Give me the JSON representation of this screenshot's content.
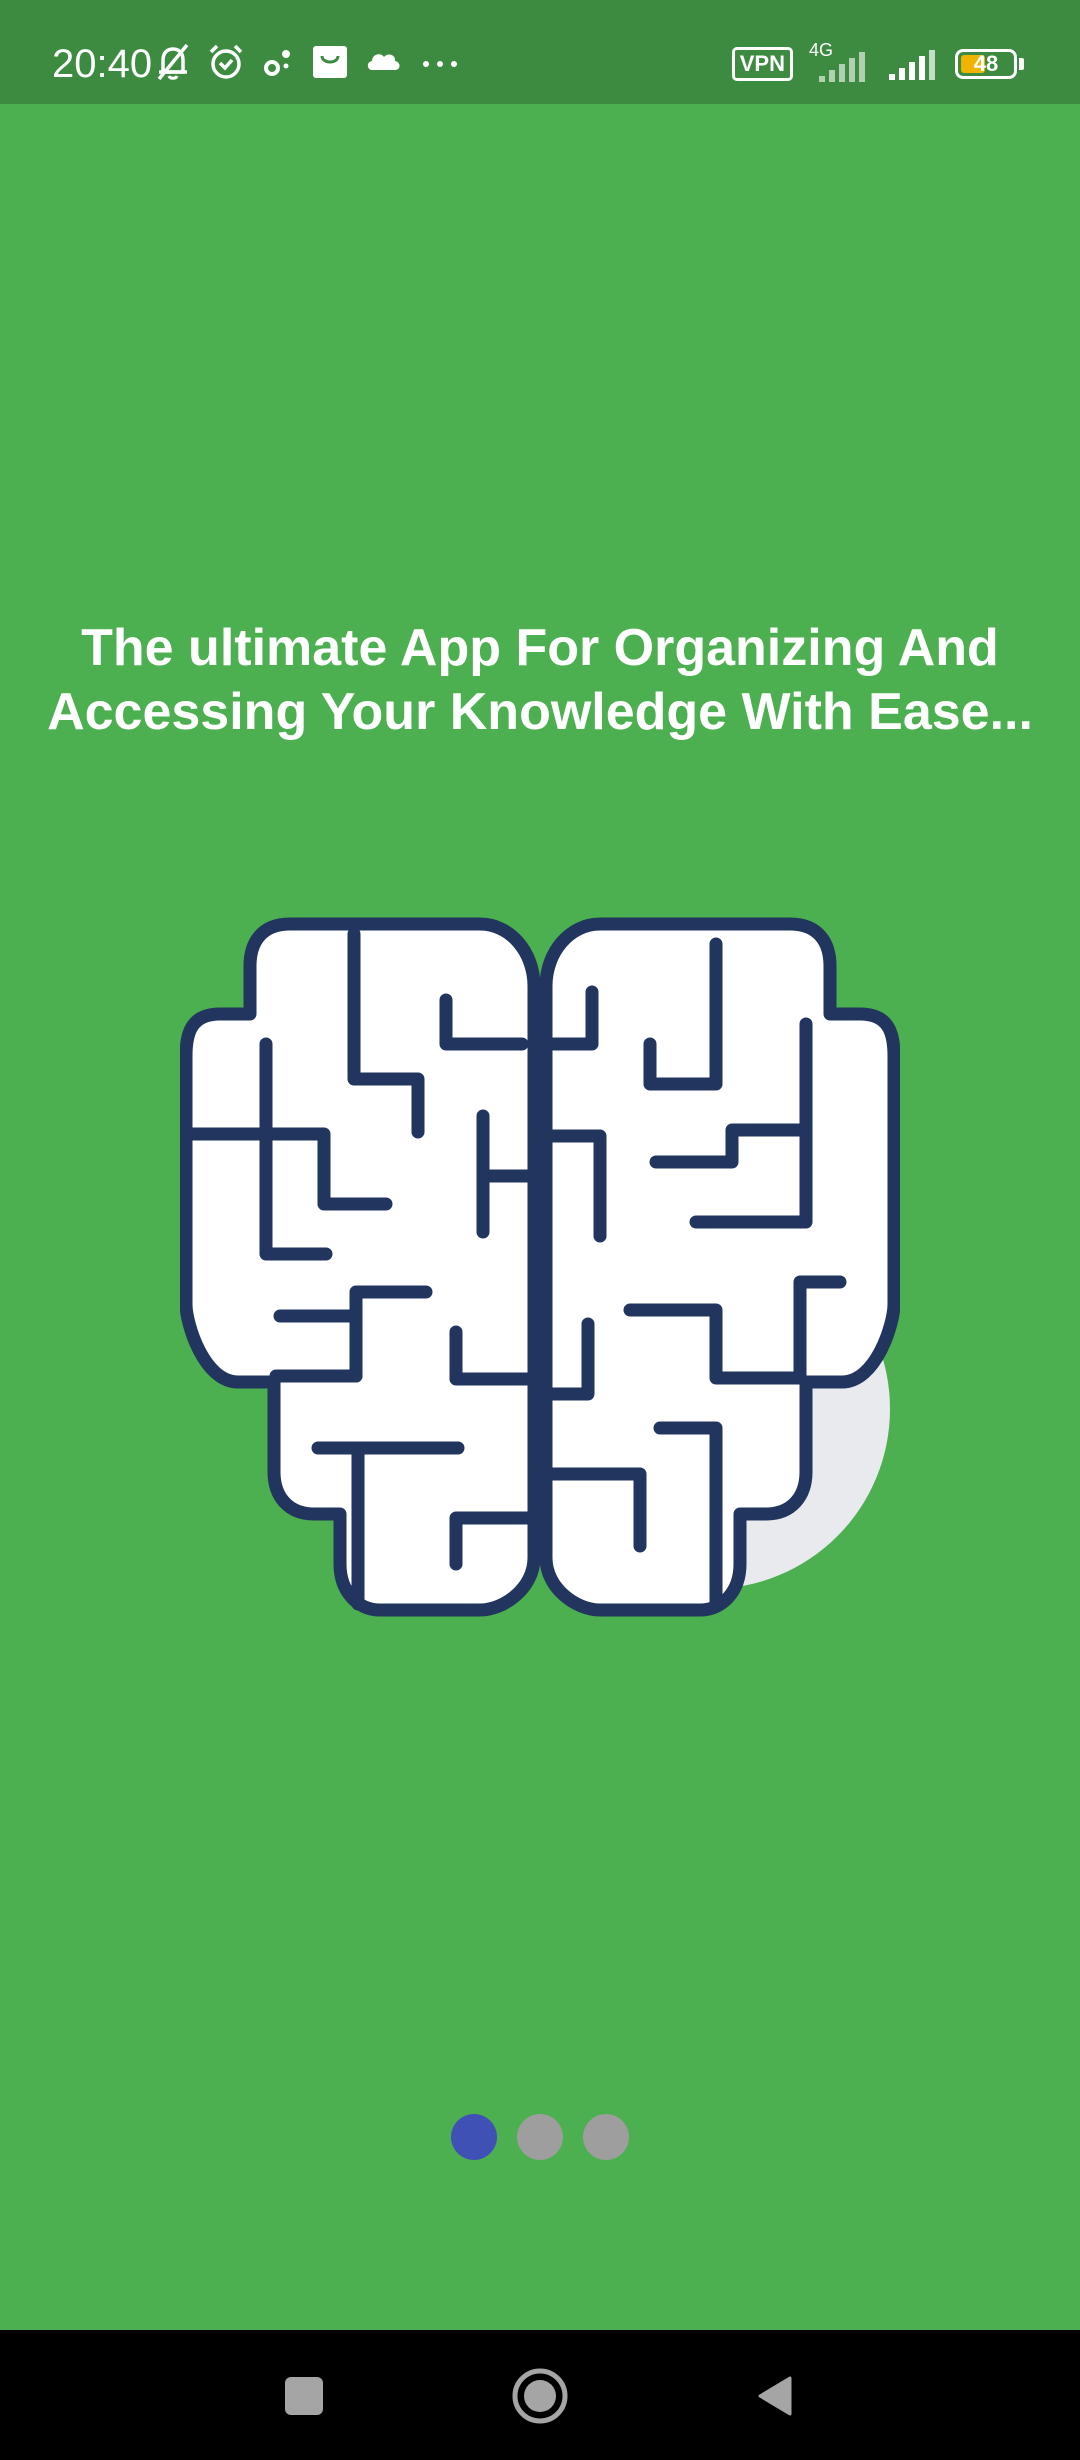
{
  "status_bar": {
    "time": "20:40",
    "vpn_label": "VPN",
    "network_label": "4G",
    "battery_level": "48",
    "battery_fraction": 0.48,
    "icons_left": [
      "bell-off-icon",
      "alarm-icon",
      "wifi-gear-icon",
      "shopping-bag-icon",
      "cloud-icon",
      "more-dots-icon"
    ],
    "icons_right": [
      "vpn-icon",
      "signal-4g-icon",
      "signal-icon",
      "battery-icon"
    ]
  },
  "onboarding": {
    "headline_line1": "The ultimate App For Organizing And",
    "headline_line2": "Accessing Your Knowledge With Ease...",
    "illustration": "brain-maze-icon",
    "page_indicator": {
      "total": 3,
      "current": 1
    }
  },
  "nav_bar": {
    "buttons": [
      "recents-square-icon",
      "home-circle-icon",
      "back-triangle-icon"
    ]
  },
  "colors": {
    "background": "#4caf50",
    "status_bar": "#3d8b40",
    "brain_outline": "#22355e",
    "brain_fill": "#ffffff",
    "brain_shadow": "#e8eaee",
    "dot_active": "#3f51b5",
    "dot_inactive": "#9e9e9e",
    "nav_bar": "#000000"
  }
}
